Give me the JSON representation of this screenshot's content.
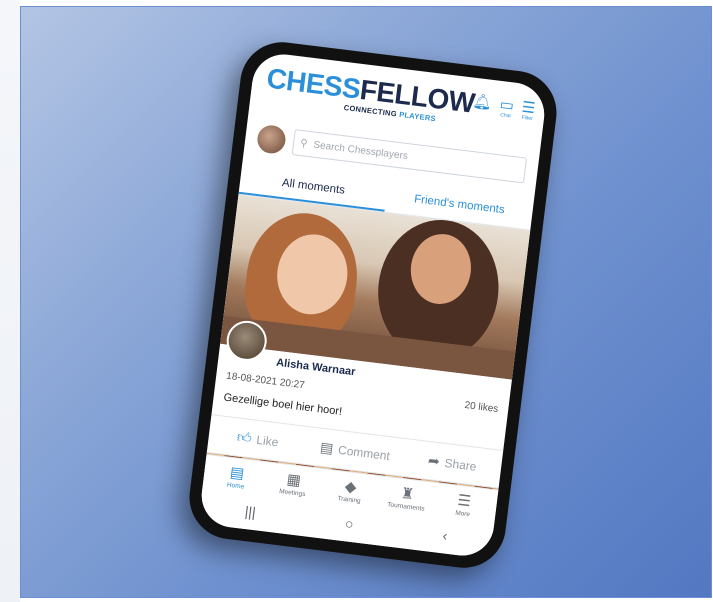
{
  "app": {
    "logo_part1": "CHESS",
    "logo_part2": "FELLOW",
    "tagline_part1": "CONNECTING",
    "tagline_part2": "PLAYERS"
  },
  "header_icons": [
    {
      "icon": "bell-icon",
      "label": ""
    },
    {
      "icon": "chat-icon",
      "label": "Chat"
    },
    {
      "icon": "filter-icon",
      "label": "Filter"
    }
  ],
  "search": {
    "placeholder": "Search Chessplayers"
  },
  "tabs": [
    {
      "label": "All moments",
      "active": true
    },
    {
      "label": "Friend's moments",
      "active": false
    }
  ],
  "post": {
    "author": "Alisha Warnaar",
    "timestamp": "18-08-2021 20:27",
    "likes": "20 likes",
    "caption": "Gezellige boel hier hoor!"
  },
  "actions": {
    "like": "Like",
    "comment": "Comment",
    "share": "Share"
  },
  "bottom_nav": [
    {
      "label": "Home",
      "icon": "home-icon",
      "active": true
    },
    {
      "label": "Meetings",
      "icon": "calendar-icon"
    },
    {
      "label": "Training",
      "icon": "graduation-cap-icon"
    },
    {
      "label": "Tournaments",
      "icon": "rook-icon"
    },
    {
      "label": "More",
      "icon": "menu-icon"
    }
  ],
  "system_nav": {
    "recents": "|||",
    "home": "○",
    "back": "‹"
  },
  "colors": {
    "accent": "#2b8fd9",
    "navy": "#1c2a4e",
    "background_gradient_start": "#b3c5e4",
    "background_gradient_end": "#5378c2"
  }
}
